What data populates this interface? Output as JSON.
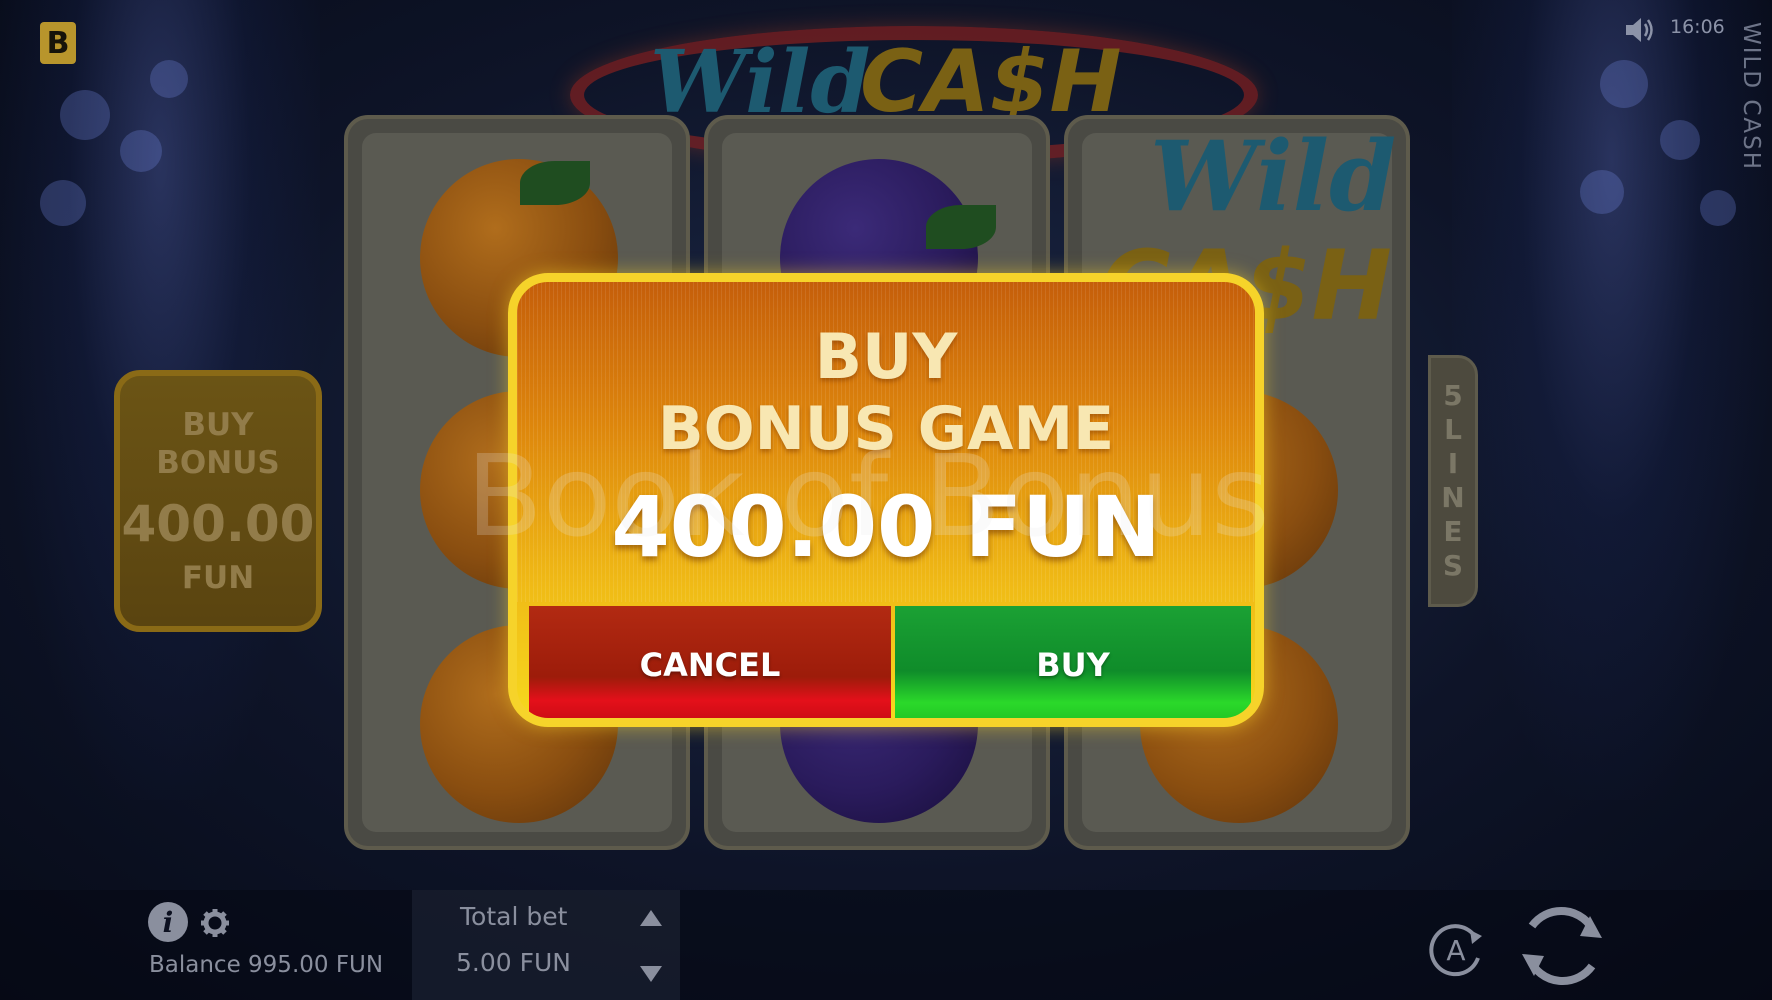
{
  "game": {
    "title": "WILD CASH",
    "logo_word_1": "Wild",
    "logo_word_2": "CA$H",
    "brand_letter": "B",
    "clock": "16:06",
    "lines_badge": [
      "5",
      "L",
      "I",
      "N",
      "E",
      "S"
    ],
    "watermark": "Book of Bonus"
  },
  "buy_bonus_panel": {
    "line1": "BUY",
    "line2": "BONUS",
    "price": "400.00",
    "unit": "FUN"
  },
  "modal": {
    "title_line1": "BUY",
    "title_line2": "BONUS GAME",
    "price": "400.00 FUN",
    "cancel_label": "CANCEL",
    "buy_label": "BUY"
  },
  "bottom_bar": {
    "balance": "Balance 995.00 FUN",
    "total_bet_label": "Total bet",
    "total_bet_value": "5.00 FUN",
    "autoplay_letter": "A"
  },
  "icons": {
    "sound": "speaker-icon",
    "info": "info-icon",
    "settings": "gear-icon",
    "autoplay": "autoplay-icon",
    "spin": "spin-icon"
  },
  "colors": {
    "modal_border": "#f6d32a",
    "cancel": "#c70b14",
    "buy": "#1fc224",
    "brand": "#b8952c"
  }
}
